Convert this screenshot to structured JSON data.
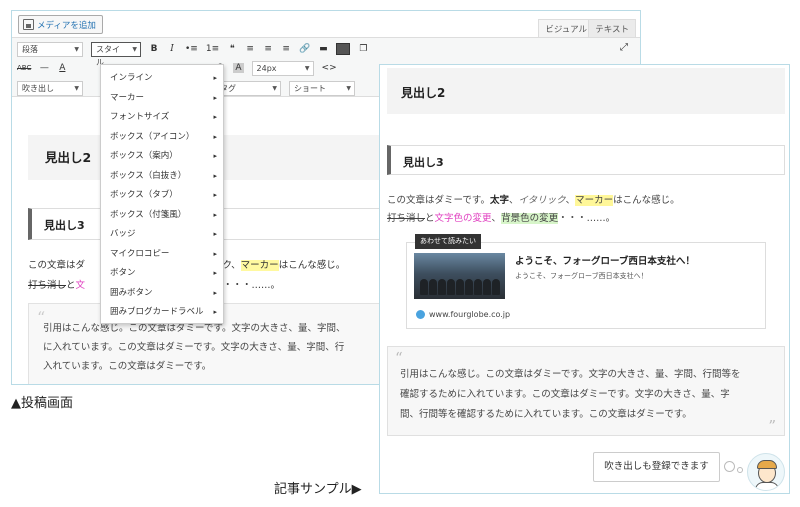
{
  "editor": {
    "media_button": "メディアを追加",
    "tabs": {
      "visual": "ビジュアル",
      "text": "テキスト"
    },
    "toolbar": {
      "format_select": "段落",
      "style_select": "スタイル",
      "row1_icons": [
        "B",
        "I",
        "•≡",
        "1≡",
        "❝",
        "≡",
        "≡",
        "≡",
        "🔗",
        "▬",
        "▦",
        "❐"
      ],
      "row2_icons": [
        "ABC",
        "—",
        "A",
        "?",
        "A",
        "24px",
        "<>"
      ],
      "fontsize_select": "24px",
      "row3_selects": [
        "吹き出し",
        "タグ",
        "ショートコ..."
      ]
    },
    "content": {
      "h2": "見出し2",
      "h3": "見出し3",
      "para_line1_pre": "この文章はダ",
      "para_line1_mid": "ック、",
      "para_line1_marker": "マーカー",
      "para_line1_post": "はこんな感じ。",
      "para_line2_strike": "打ち消し",
      "para_line2_a": "と",
      "para_line2_b": "文",
      "para_line2_post": "・・・……。",
      "quote_lines": [
        "引用はこんな感じ。この文章はダミーです。文字の大きさ、量、字間、",
        "に入れています。この文章はダミーです。文字の大きさ、量、字間、行",
        "入れています。この文章はダミーです。"
      ]
    },
    "style_menu": [
      "インライン",
      "マーカー",
      "フォントサイズ",
      "ボックス（アイコン）",
      "ボックス（案内）",
      "ボックス（白抜き）",
      "ボックス（タブ）",
      "ボックス（付箋風）",
      "バッジ",
      "マイクロコピー",
      "ボタン",
      "囲みボタン",
      "囲みブログカードラベル"
    ]
  },
  "caption_left": "▲投稿画面",
  "article": {
    "h2": "見出し2",
    "h3": "見出し3",
    "line1": {
      "a": "この文章はダミーです。",
      "bold": "太字",
      "b": "、",
      "italic": "イタリック",
      "c": "、",
      "marker": "マーカー",
      "d": "はこんな感じ。"
    },
    "line2": {
      "strike": "打ち消し",
      "a": "と",
      "pink": "文字色の変更",
      "b": "、",
      "green": "背景色の変更",
      "c": "・・・……。"
    },
    "blogcard": {
      "label": "あわせて読みたい",
      "title": "ようこそ、フォーグローブ西日本支社へ！",
      "desc": "ようこそ、フォーグローブ西日本支社へ！",
      "url": "www.fourglobe.co.jp"
    },
    "quote_lines": [
      "引用はこんな感じ。この文章はダミーです。文字の大きさ、量、字間、行間等を",
      "確認するために入れています。この文章はダミーです。文字の大きさ、量、字",
      "間、行間等を確認するために入れています。この文章はダミーです。"
    ],
    "speech_bubble": "吹き出しも登録できます"
  },
  "caption_right": "記事サンプル▶"
}
